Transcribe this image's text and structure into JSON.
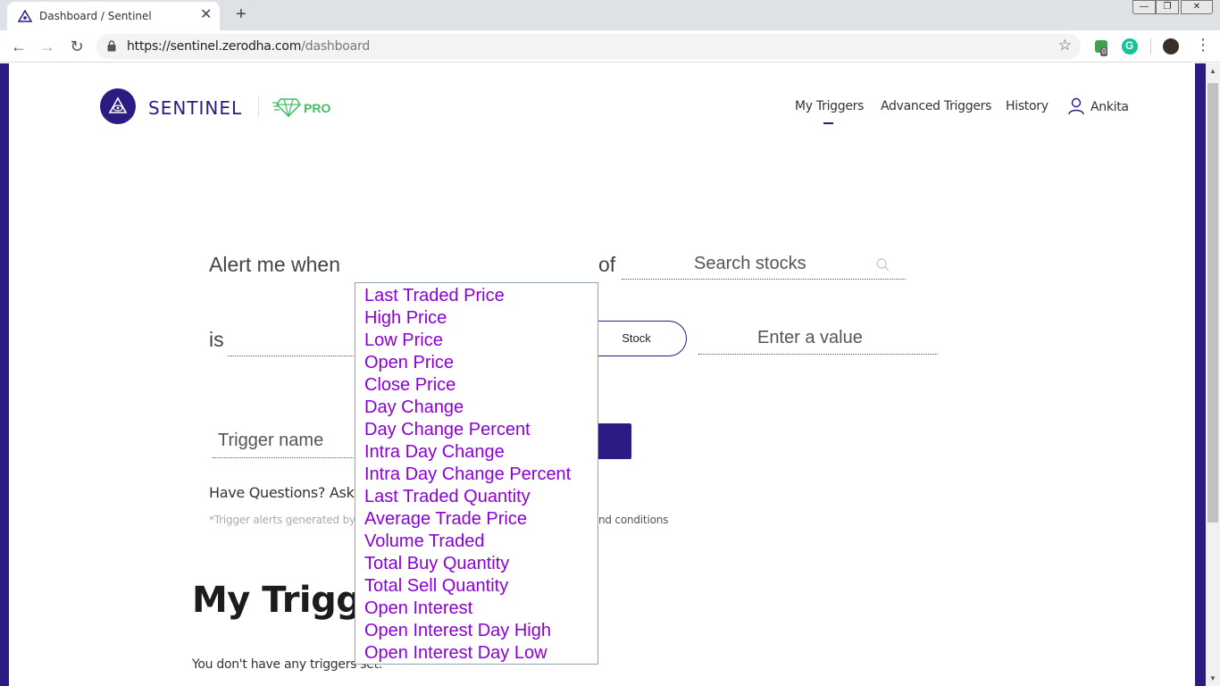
{
  "browser": {
    "tab_title": "Dashboard / Sentinel",
    "tab_close": "✕",
    "new_tab": "+",
    "url_host": "https://sentinel.zerodha.com",
    "url_path": "/dashboard",
    "window_minimize": "—",
    "window_maximize": "❐",
    "window_close": "✕",
    "extension_badge": "0",
    "grammarly_letter": "G"
  },
  "header": {
    "brand": "SENTINEL",
    "pro_label": "PRO",
    "nav": [
      {
        "label": "My Triggers",
        "active": true
      },
      {
        "label": "Advanced Triggers"
      },
      {
        "label": "History"
      }
    ],
    "user_name": "Ankita"
  },
  "form": {
    "alert_prefix": "Alert me when",
    "of_label": "of",
    "search_placeholder": "Search stocks",
    "is_label": "is",
    "stock_button": "Stock",
    "value_placeholder": "Enter a value",
    "trigger_name_placeholder": "Trigger name",
    "questions_text": "Have Questions? Ask H",
    "disclaimer_start": "*Trigger alerts generated by",
    "disclaimer_end": "nd conditions"
  },
  "attribute_dropdown": {
    "options": [
      "Last Traded Price",
      "High Price",
      "Low Price",
      "Open Price",
      "Close Price",
      "Day Change",
      "Day Change Percent",
      "Intra Day Change",
      "Intra Day Change Percent",
      "Last Traded Quantity",
      "Average Trade Price",
      "Volume Traded",
      "Total Buy Quantity",
      "Total Sell Quantity",
      "Open Interest",
      "Open Interest Day High",
      "Open Interest Day Low"
    ]
  },
  "triggers_section": {
    "heading": "My Trigge",
    "empty_message": "You don't have any triggers set."
  },
  "colors": {
    "brand_purple": "#2d1a82",
    "pro_green": "#3fbf62",
    "dropdown_text": "#8a00d6"
  },
  "icons": [
    "sentinel-logo-icon",
    "pro-diamond-icon",
    "search-icon",
    "user-icon",
    "lock-icon",
    "star-icon"
  ]
}
